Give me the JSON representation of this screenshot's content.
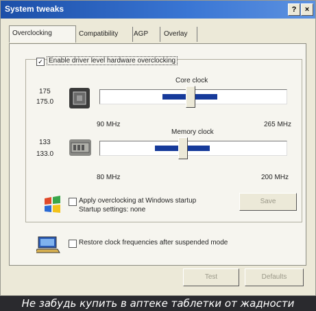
{
  "window": {
    "title": "System tweaks",
    "help_label": "?",
    "close_label": "×"
  },
  "tabs": [
    {
      "label": "Overclocking"
    },
    {
      "label": "Compatibility"
    },
    {
      "label": "AGP"
    },
    {
      "label": "Overlay"
    }
  ],
  "overclocking": {
    "enable_label": "Enable driver level hardware overclocking",
    "enable_checked": "✓",
    "core": {
      "title": "Core clock",
      "value_top": "175",
      "value_bottom": "175.0",
      "min_label": "90 MHz",
      "max_label": "265 MHz",
      "value": 175,
      "min": 90,
      "max": 265
    },
    "memory": {
      "title": "Memory clock",
      "value_top": "133",
      "value_bottom": "133.0",
      "min_label": "80 MHz",
      "max_label": "200 MHz",
      "value": 133,
      "min": 80,
      "max": 200
    },
    "startup_label": "Apply overclocking at Windows startup",
    "startup_settings": "Startup settings: none",
    "save_button": "Save",
    "restore_label": "Restore clock frequencies after suspended mode",
    "test_button": "Test",
    "defaults_button": "Defaults"
  },
  "caption": "Не забудь купить в аптеке таблетки от жадности",
  "colors": {
    "titlebar": "#2a62c4",
    "slider_range": "#163a9a",
    "caption_bg": "#2a2a2e"
  }
}
